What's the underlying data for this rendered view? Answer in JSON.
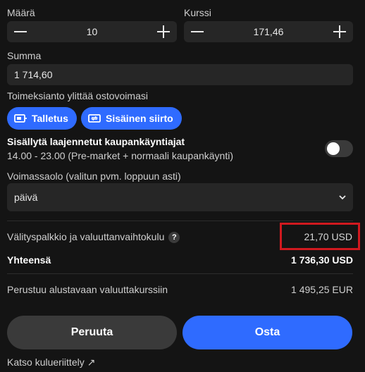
{
  "quantity": {
    "label": "Määrä",
    "value": "10"
  },
  "price": {
    "label": "Kurssi",
    "value": "171,46"
  },
  "sum": {
    "label": "Summa",
    "value": "1 714,60"
  },
  "warning": "Toimeksianto ylittää ostovoimasi",
  "buttons": {
    "deposit": "Talletus",
    "transfer": "Sisäinen siirto",
    "cancel": "Peruuta",
    "buy": "Osta"
  },
  "extended_hours": {
    "title": "Sisällytä laajennetut kaupankäyntiajat",
    "subtitle": "14.00 - 23.00 (Pre-market + normaali kaupankäynti)",
    "enabled": false
  },
  "validity": {
    "label": "Voimassaolo (valitun pvm. loppuun asti)",
    "value": "päivä"
  },
  "fees": {
    "label": "Välityspalkkio ja valuuttanvaihtokulu",
    "help": "?",
    "value": "21,70 USD"
  },
  "total": {
    "label": "Yhteensä",
    "value": "1 736,30 USD"
  },
  "fx": {
    "label": "Perustuu alustavaan valuuttakurssiin",
    "value": "1 495,25 EUR"
  },
  "fee_breakdown_link": "Katso kulueriittely ↗",
  "colors": {
    "accent": "#2f6bff",
    "highlight": "#d0191f",
    "background": "#141414"
  }
}
